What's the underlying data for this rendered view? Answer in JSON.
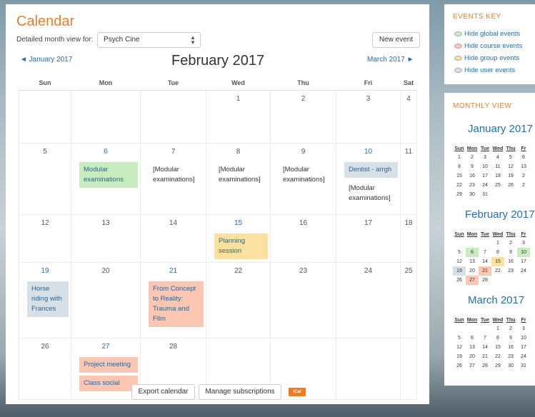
{
  "main": {
    "title": "Calendar",
    "view_label": "Detailed month view for:",
    "course_select": "Psych Cine",
    "new_event_button": "New event",
    "prev_month": "◄ January 2017",
    "next_month": "March 2017 ►",
    "month_heading": "February 2017",
    "weekdays": [
      "Sun",
      "Mon",
      "Tue",
      "Wed",
      "Thu",
      "Fri",
      "Sat"
    ],
    "weeks": [
      [
        {
          "d": ""
        },
        {
          "d": ""
        },
        {
          "d": ""
        },
        {
          "d": "1"
        },
        {
          "d": "2"
        },
        {
          "d": "3"
        },
        {
          "d": "4"
        }
      ],
      [
        {
          "d": "5"
        },
        {
          "d": "6",
          "hl": true,
          "ev": [
            {
              "t": "Modular examinations",
              "type": "global"
            }
          ]
        },
        {
          "d": "7",
          "ev": [
            {
              "t": "[Modular examinations]",
              "type": "plain"
            }
          ]
        },
        {
          "d": "8",
          "ev": [
            {
              "t": "[Modular examinations]",
              "type": "plain"
            }
          ]
        },
        {
          "d": "9",
          "ev": [
            {
              "t": "[Modular examinations]",
              "type": "plain"
            }
          ]
        },
        {
          "d": "10",
          "hl": true,
          "ev": [
            {
              "t": "Dentist - arrgh",
              "type": "user"
            },
            {
              "t": "[Modular examinations]",
              "type": "plain"
            }
          ]
        },
        {
          "d": "11"
        }
      ],
      [
        {
          "d": "12"
        },
        {
          "d": "13"
        },
        {
          "d": "14"
        },
        {
          "d": "15",
          "hl": true,
          "ev": [
            {
              "t": "Planning session",
              "type": "group"
            }
          ]
        },
        {
          "d": "16"
        },
        {
          "d": "17"
        },
        {
          "d": "18"
        }
      ],
      [
        {
          "d": "19",
          "hl": true,
          "ev": [
            {
              "t": "Horse riding with Frances",
              "type": "user"
            }
          ]
        },
        {
          "d": "20"
        },
        {
          "d": "21",
          "hl": true,
          "ev": [
            {
              "t": "From Concept to Reality: Trauma and Film",
              "type": "course"
            }
          ]
        },
        {
          "d": "22"
        },
        {
          "d": "23"
        },
        {
          "d": "24"
        },
        {
          "d": "25"
        }
      ],
      [
        {
          "d": "26"
        },
        {
          "d": "27",
          "hl": true,
          "ev": [
            {
              "t": "Project meeting",
              "type": "course"
            },
            {
              "t": "Class social",
              "type": "course"
            }
          ]
        },
        {
          "d": "28"
        },
        {
          "d": ""
        },
        {
          "d": ""
        },
        {
          "d": ""
        },
        {
          "d": ""
        }
      ]
    ],
    "export_button": "Export calendar",
    "manage_button": "Manage subscriptions",
    "ical_badge": "iCal"
  },
  "events_key": {
    "title": "EVENTS KEY",
    "items": [
      {
        "label": "Hide global events",
        "color": "#c8ecc0"
      },
      {
        "label": "Hide course events",
        "color": "#fbc7b3"
      },
      {
        "label": "Hide group events",
        "color": "#fbe1a0"
      },
      {
        "label": "Hide user events",
        "color": "#d6e0e6"
      }
    ]
  },
  "monthly_view": {
    "title": "MONTHLY VIEW",
    "weekday_abbr": [
      "Sun",
      "Mon",
      "Tue",
      "Wed",
      "Thu",
      "Fr"
    ],
    "months": [
      {
        "name": "January 2017",
        "weeks": [
          [
            "1",
            "2",
            "3",
            "4",
            "5",
            "6"
          ],
          [
            "8",
            "9",
            "10",
            "11",
            "12",
            "13"
          ],
          [
            "15",
            "16",
            "17",
            "18",
            "19",
            "2"
          ],
          [
            "22",
            "23",
            "24",
            "25",
            "26",
            "2"
          ],
          [
            "29",
            "30",
            "31",
            "",
            "",
            ""
          ]
        ]
      },
      {
        "name": "February 2017",
        "weeks": [
          [
            "",
            "",
            "",
            "1",
            "2",
            "3"
          ],
          [
            "5",
            "6",
            "7",
            "8",
            "9",
            "10"
          ],
          [
            "12",
            "13",
            "14",
            "15",
            "16",
            "17"
          ],
          [
            "19",
            "20",
            "21",
            "22",
            "23",
            "24"
          ],
          [
            "26",
            "27",
            "28",
            "",
            "",
            ""
          ]
        ],
        "marks": {
          "6": "gl",
          "10": "gl",
          "15": "g",
          "19": "u",
          "21": "c",
          "27": "c"
        }
      },
      {
        "name": "March 2017",
        "weeks": [
          [
            "",
            "",
            "",
            "1",
            "2",
            "3"
          ],
          [
            "5",
            "6",
            "7",
            "8",
            "9",
            "10"
          ],
          [
            "12",
            "13",
            "14",
            "15",
            "16",
            "17"
          ],
          [
            "19",
            "20",
            "21",
            "22",
            "23",
            "24"
          ],
          [
            "26",
            "27",
            "28",
            "29",
            "30",
            "31"
          ]
        ]
      }
    ]
  },
  "colors": {
    "accent": "#ef7d29",
    "link": "#1f6fb3",
    "course_event": "#fbc7b3",
    "group_event": "#fbe1a0",
    "user_event": "#d6e0e6",
    "global_event": "#c8ecc0"
  }
}
